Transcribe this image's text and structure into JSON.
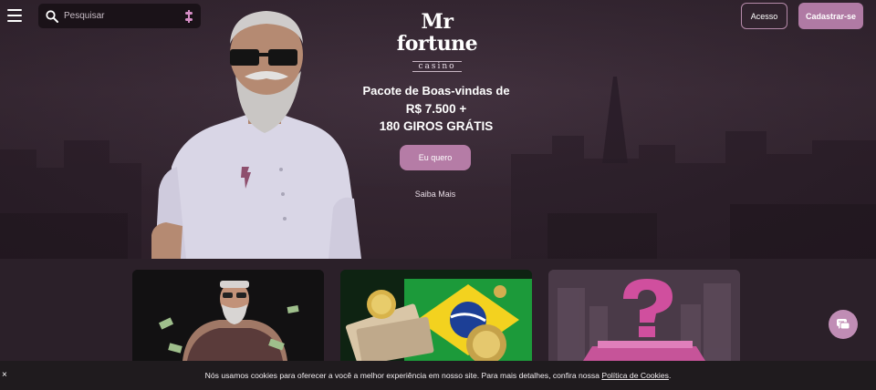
{
  "header": {
    "search_placeholder": "Pesquisar",
    "logo_brand": "Mr fortune",
    "logo_sub": "casino",
    "login_label": "Acesso",
    "signup_label": "Cadastrar-se"
  },
  "promo": {
    "line1": "Pacote de Boas-vindas de",
    "line2": "R$ 7.500 +",
    "line3": "180 GIROS GRÁTIS",
    "cta_label": "Eu quero",
    "learn_more_label": "Saiba Mais"
  },
  "cookie": {
    "close_label": "×",
    "text": "Nós usamos cookies para oferecer a você a melhor experiência em nosso site. Para mais detalhes, confira nossa",
    "link_label": "Política de Cookies",
    "suffix": "."
  },
  "colors": {
    "accent": "#b57ca6",
    "background": "#2a1f28",
    "cookie_bar": "#1f1b1e"
  },
  "icons": {
    "menu": "menu-icon",
    "search": "search-icon",
    "filter": "filter-icon",
    "chat": "chat-icon"
  }
}
